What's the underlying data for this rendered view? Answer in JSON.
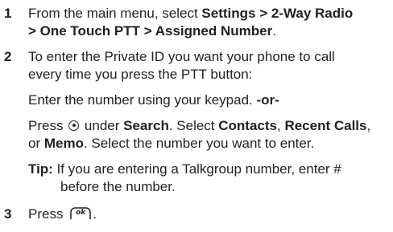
{
  "steps": [
    {
      "number": "1",
      "text_before": "From the main menu, select ",
      "menu_path_line1": "Settings > 2-Way Radio",
      "menu_path_line2": "> One Touch PTT > Assigned Number",
      "text_after": "."
    },
    {
      "number": "2",
      "intro_line1": "To enter the Private ID you want your phone to call",
      "intro_line2": "every time you press the PTT button:",
      "option1_text": "Enter the number using your keypad. ",
      "option1_or": "-or-",
      "option2_press": "Press ",
      "option2_under": " under ",
      "option2_search": "Search",
      "option2_select": ". Select ",
      "option2_contacts": "Contacts",
      "option2_comma": ", ",
      "option2_recent": "Recent Calls",
      "option2_comma2": ",",
      "option2_or": "or ",
      "option2_memo": "Memo",
      "option2_rest": ". Select the number you want to enter.",
      "tip_label": "Tip:",
      "tip_line1": " If you are entering a Talkgroup number, enter #",
      "tip_line2": "before the number."
    },
    {
      "number": "3",
      "press_text": "Press ",
      "ok_key_label": "ok",
      "end_text": "."
    }
  ],
  "icons": {
    "nav_key": "center-select-key-icon",
    "ok_key": "ok-key-icon"
  }
}
